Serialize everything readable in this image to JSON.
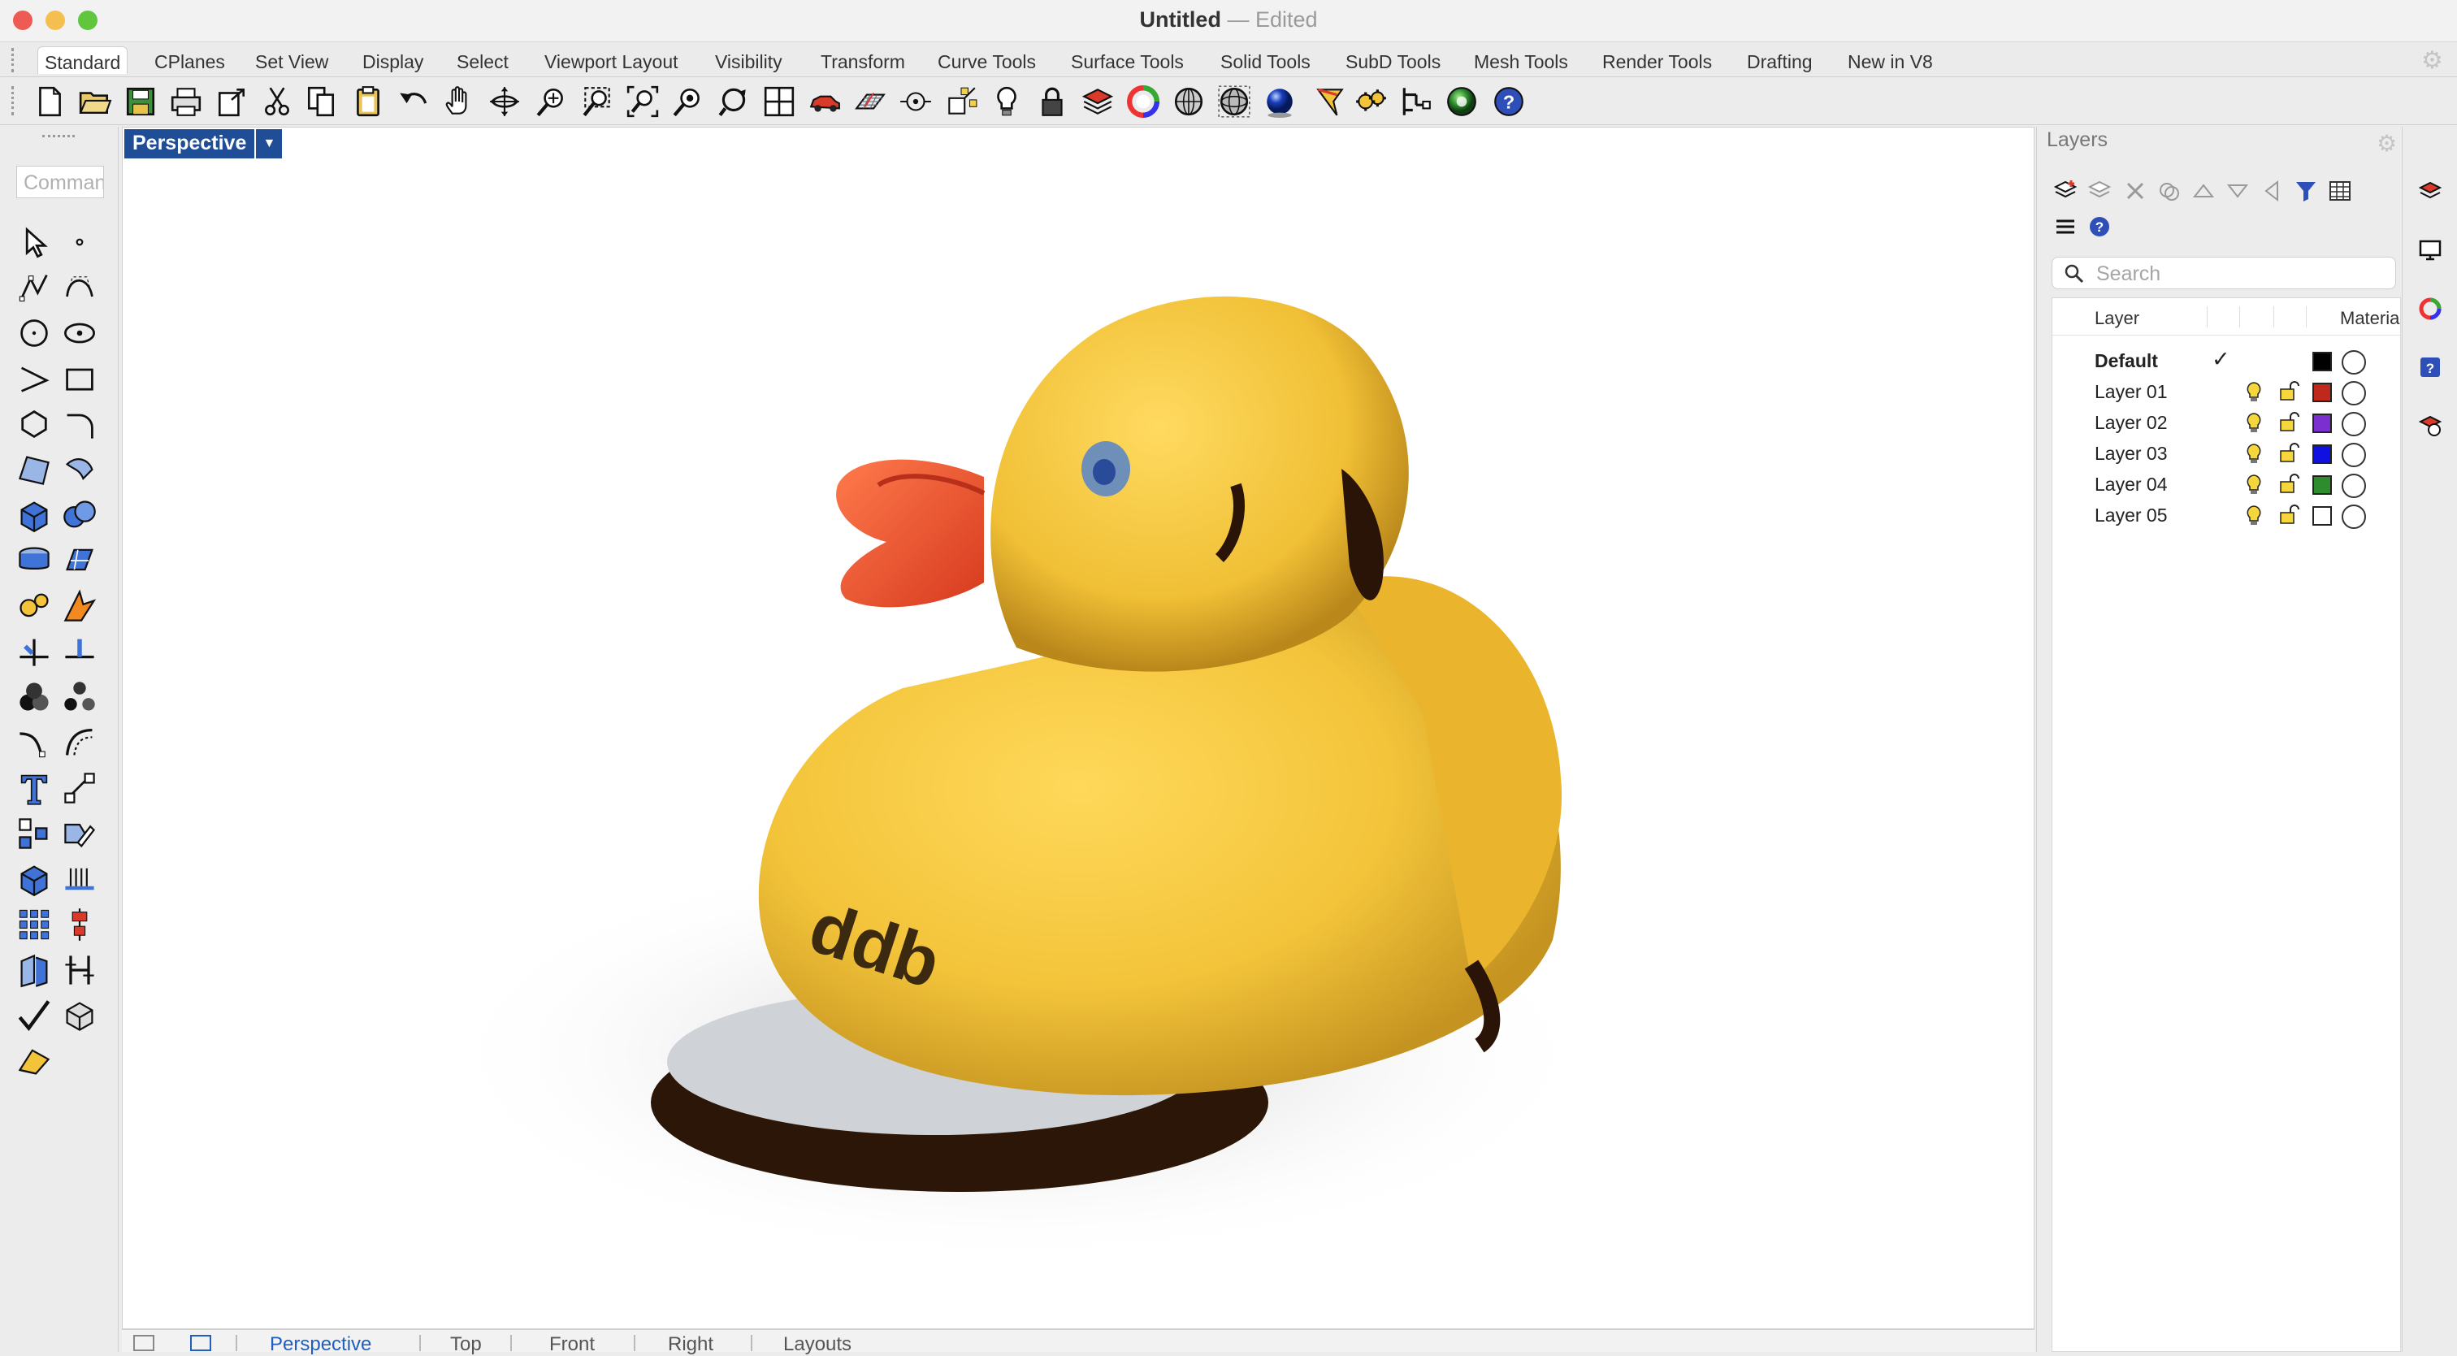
{
  "window": {
    "title": "Untitled",
    "separator": " — ",
    "status": "Edited"
  },
  "tabs": [
    "Standard",
    "CPlanes",
    "Set View",
    "Display",
    "Select",
    "Viewport Layout",
    "Visibility",
    "Transform",
    "Curve Tools",
    "Surface Tools",
    "Solid Tools",
    "SubD Tools",
    "Mesh Tools",
    "Render Tools",
    "Drafting",
    "New in V8"
  ],
  "active_tab": "Standard",
  "command": {
    "placeholder": "Command"
  },
  "viewport": {
    "name": "Perspective",
    "logo_text": "ddb"
  },
  "view_tabs": [
    "Perspective",
    "Top",
    "Front",
    "Right",
    "Layouts"
  ],
  "layers_panel": {
    "title": "Layers",
    "search_placeholder": "Search",
    "col_layer": "Layer",
    "col_material": "Materia",
    "rows": [
      {
        "name": "Default",
        "current": true,
        "current_mark": "✓",
        "color": "#000000"
      },
      {
        "name": "Layer 01",
        "current": false,
        "color": "#c0281c"
      },
      {
        "name": "Layer 02",
        "current": false,
        "color": "#7b2fd0"
      },
      {
        "name": "Layer 03",
        "current": false,
        "color": "#1010e0"
      },
      {
        "name": "Layer 04",
        "current": false,
        "color": "#2e8b2e"
      },
      {
        "name": "Layer 05",
        "current": false,
        "color": "#ffffff"
      }
    ]
  },
  "colors": {
    "accent": "#1f4e96",
    "close": "#ee5b52",
    "minimize": "#f5bf4f",
    "maximize": "#5fc63e",
    "duck": "#f3c43a",
    "beak": "#e8502e"
  },
  "icons": {
    "toolbar": [
      "new-file-icon",
      "open-folder-icon",
      "save-icon",
      "print-icon",
      "export-icon",
      "cut-icon",
      "copy-icon",
      "paste-icon",
      "undo-icon",
      "pan-hand-icon",
      "rotate-view-icon",
      "zoom-icon",
      "zoom-window-icon",
      "zoom-extents-icon",
      "zoom-selected-icon",
      "rotate-camera-icon",
      "four-viewports-icon",
      "car-display-icon",
      "grid-plane-icon",
      "gumball-icon",
      "osnap-icon",
      "light-bulb-icon",
      "lock-icon",
      "layer-icon",
      "color-wheel-icon",
      "sphere-wire-icon",
      "mesh-sphere-icon",
      "render-sphere-icon",
      "flag-icon",
      "gear-tools-icon",
      "grid-tools-icon",
      "globe-icon",
      "help-icon"
    ],
    "sidebar": [
      "select-arrow-icon",
      "point-icon",
      "polyline-icon",
      "curve-icon",
      "circle-icon",
      "ellipse-icon",
      "arc-icon",
      "rectangle-icon",
      "polygon-icon",
      "fillet-icon",
      "surface-icon",
      "sweep-icon",
      "box-icon",
      "boolean-icon",
      "extrude-icon",
      "planar-icon",
      "gear-solid-icon",
      "explode-icon",
      "trim-icon",
      "split-icon",
      "group-icon",
      "ungroup-icon",
      "blend-icon",
      "offset-icon",
      "text-icon",
      "dimension-icon",
      "array-icon",
      "edit-icon",
      "solid-box-icon",
      "hatch-icon",
      "grid-array-icon",
      "align-icon",
      "transform-icon",
      "rebuild-icon",
      "check-icon",
      "render-shape-icon",
      "drafting-icon"
    ]
  }
}
